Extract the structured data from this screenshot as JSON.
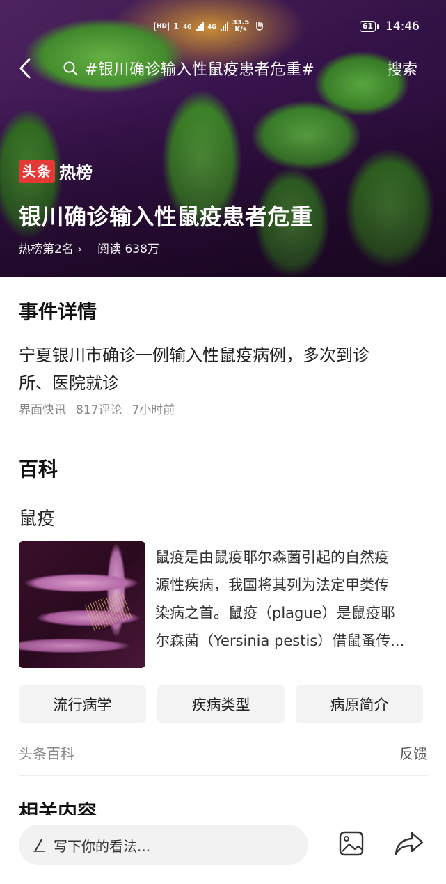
{
  "status_bar": {
    "hd": "HD",
    "sim": "1",
    "signal1": "4G",
    "signal2": "4G",
    "net_speed_value": "33.5",
    "net_speed_unit": "K/s",
    "battery": "61",
    "time": "14:46"
  },
  "nav": {
    "search_query": "#银川确诊输入性鼠疫患者危重#",
    "search_button": "搜索"
  },
  "hero": {
    "brand_badge": "头条",
    "brand_label": "热榜",
    "title": "银川确诊输入性鼠疫患者危重",
    "rank": "热榜第2名",
    "reads": "阅读 638万"
  },
  "event": {
    "section_title": "事件详情",
    "description_line1": "宁夏银川市确诊一例输入性鼠疫病例，多次到诊",
    "description_line2": "所、医院就诊",
    "source": "界面快讯",
    "comments": "817评论",
    "time": "7小时前"
  },
  "encyclopedia": {
    "section_title": "百科",
    "term": "鼠疫",
    "summary_lines": [
      "鼠疫是由鼠疫耶尔森菌引起的自然疫",
      "源性疾病，我国将其列为法定甲类传",
      "染病之首。鼠疫（plague）是鼠疫耶",
      "尔森菌（Yersinia pestis）借鼠蚤传..."
    ],
    "tags": [
      "流行病学",
      "疾病类型",
      "病原简介"
    ],
    "source": "头条百科",
    "feedback": "反馈"
  },
  "related": {
    "section_title": "相关内容"
  },
  "bottom_bar": {
    "comment_placeholder": "写下你的看法..."
  },
  "colors": {
    "brand_red": "#e53935",
    "tag_bg": "#f3f3f3",
    "muted_text": "#888888"
  },
  "icons": [
    "back-arrow-icon",
    "search-icon",
    "pen-icon",
    "image-icon",
    "share-icon"
  ]
}
